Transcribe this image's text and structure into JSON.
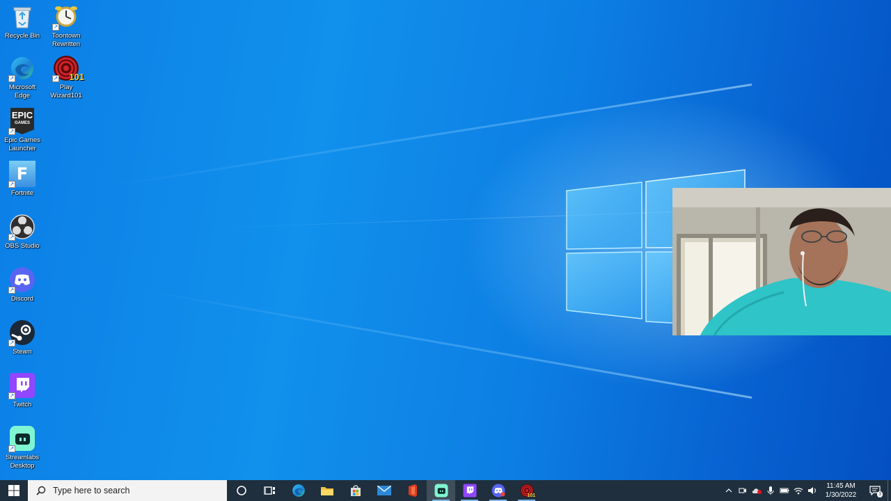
{
  "desktop": {
    "icons": [
      {
        "label": "Recycle Bin",
        "icon": "recycle-bin-icon",
        "shortcut": false
      },
      {
        "label": "Toontown Rewritten",
        "icon": "toontown-icon",
        "shortcut": true
      },
      {
        "label": "Microsoft Edge",
        "icon": "edge-icon",
        "shortcut": true
      },
      {
        "label": "Play Wizard101",
        "icon": "wizard101-icon",
        "shortcut": true
      },
      {
        "label": "Epic Games Launcher",
        "icon": "epic-games-icon",
        "shortcut": true
      },
      {
        "label": "Fortnite",
        "icon": "fortnite-icon",
        "shortcut": true
      },
      {
        "label": "OBS Studio",
        "icon": "obs-icon",
        "shortcut": true
      },
      {
        "label": "Discord",
        "icon": "discord-icon",
        "shortcut": true
      },
      {
        "label": "Steam",
        "icon": "steam-icon",
        "shortcut": true
      },
      {
        "label": "Twitch",
        "icon": "twitch-icon",
        "shortcut": true
      },
      {
        "label": "Streamlabs Desktop",
        "icon": "streamlabs-icon",
        "shortcut": true
      }
    ],
    "epic_logo_text": "EPIC",
    "epic_logo_sub": "GAMES",
    "fortnite_letter": "F",
    "wizard_badge": "101"
  },
  "taskbar": {
    "search_placeholder": "Type here to search",
    "pinned": [
      {
        "name": "cortana",
        "icon": "cortana-circle-icon"
      },
      {
        "name": "task-view",
        "icon": "task-view-icon"
      },
      {
        "name": "edge",
        "icon": "edge-icon"
      },
      {
        "name": "file-explorer",
        "icon": "folder-icon"
      },
      {
        "name": "microsoft-store",
        "icon": "store-icon"
      },
      {
        "name": "mail",
        "icon": "mail-icon"
      },
      {
        "name": "office",
        "icon": "office-icon"
      },
      {
        "name": "streamlabs",
        "icon": "streamlabs-icon"
      },
      {
        "name": "twitch",
        "icon": "twitch-icon"
      },
      {
        "name": "discord",
        "icon": "discord-icon"
      },
      {
        "name": "wizard101",
        "icon": "wizard101-icon"
      }
    ],
    "wizard_badge": "101",
    "clock_time": "11:45 AM",
    "clock_date": "1/30/2022",
    "notification_count": "3"
  },
  "colors": {
    "taskbar_bg": "#1f2f3d",
    "desktop_blue": "#0b7ee6",
    "twitch_purple": "#9146ff",
    "discord_blurple": "#5865f2",
    "streamlabs_teal": "#80f5d2"
  }
}
